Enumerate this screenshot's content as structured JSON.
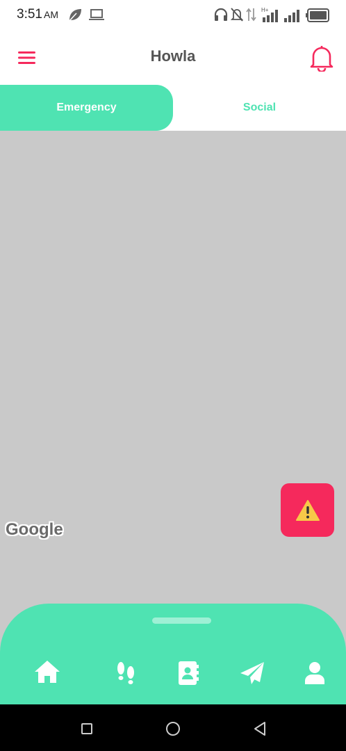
{
  "status_bar": {
    "time": "3:51",
    "ampm": "AM",
    "icons": [
      "leaf-icon",
      "laptop-icon",
      "headphones-icon",
      "mute-icon",
      "data-arrows-icon",
      "signal-h-plus-icon",
      "signal-icon",
      "battery-icon"
    ]
  },
  "app_bar": {
    "title": "Howla",
    "icons": [
      "menu-icon",
      "bell-icon"
    ]
  },
  "tabs": {
    "active": "Emergency",
    "items": [
      "Emergency",
      "Social"
    ]
  },
  "map": {
    "attribution": "Google"
  },
  "alert_fab": {
    "icon": "warning-icon"
  },
  "bottom_nav": {
    "items": [
      "home-icon",
      "footsteps-icon",
      "contacts-icon",
      "send-icon",
      "profile-icon"
    ]
  },
  "system_nav": {
    "items": [
      "recents-icon",
      "home-circle-icon",
      "back-icon"
    ]
  },
  "colors": {
    "accent": "#4fe3b2",
    "alert": "#f5295c",
    "map": "#c9c9c9",
    "title": "#555555"
  }
}
